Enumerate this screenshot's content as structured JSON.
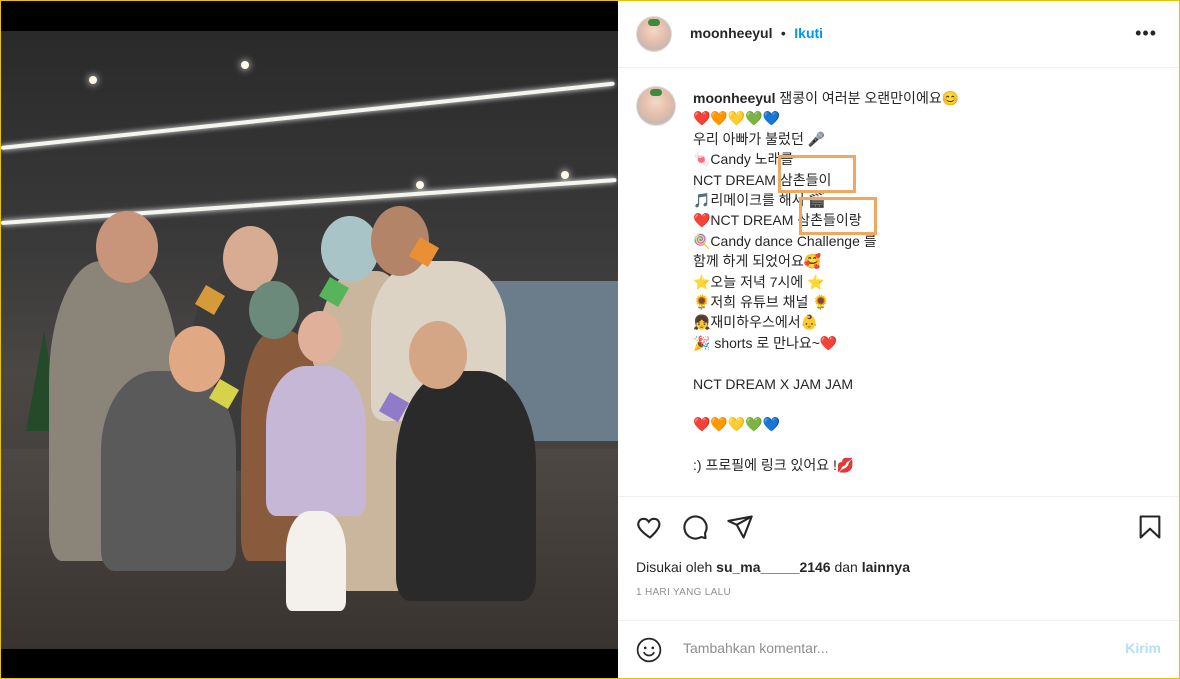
{
  "post": {
    "username": "moonheeyul",
    "separator": "•",
    "follow_label": "Ikuti",
    "more_label": "•••"
  },
  "caption": {
    "username": "moonheeyul",
    "lines": [
      "잼콩이 여러분 오랜만이에요😊",
      "❤️🧡💛💚💙",
      "우리 아빠가 불렀던 🎤",
      "🍬Candy 노래를",
      "NCT DREAM 삼촌들이",
      "🎵리메이크를 해서 🎬",
      "❤️NCT DREAM 삼촌들이랑",
      "🍭Candy dance Challenge 를",
      "함께 하게 되었어요🥰",
      "⭐오늘 저녁 7시에 ⭐",
      "🌻저희 유튜브 채널 🌻",
      "👧재미하우스에서👶",
      "🎉 shorts 로 만나요~❤️",
      "",
      "NCT DREAM X JAM JAM",
      "",
      "❤️🧡💛💚💙",
      "",
      ":) 프로필에 링크 있어요 !💋"
    ]
  },
  "actions": {
    "like_icon": "heart-icon",
    "comment_icon": "comment-icon",
    "share_icon": "share-icon",
    "save_icon": "bookmark-icon"
  },
  "likes": {
    "prefix": "Disukai oleh",
    "user": "su_ma_____2146",
    "conjunction": "dan",
    "others": "lainnya"
  },
  "timestamp": "1 HARI YANG LALU",
  "comment": {
    "placeholder": "Tambahkan komentar...",
    "post_label": "Kirim",
    "emoji_icon": "smiley-icon"
  },
  "colors": {
    "accent": "#0095f6",
    "highlight": "#f0a860",
    "post_disabled": "#b2dffc"
  }
}
